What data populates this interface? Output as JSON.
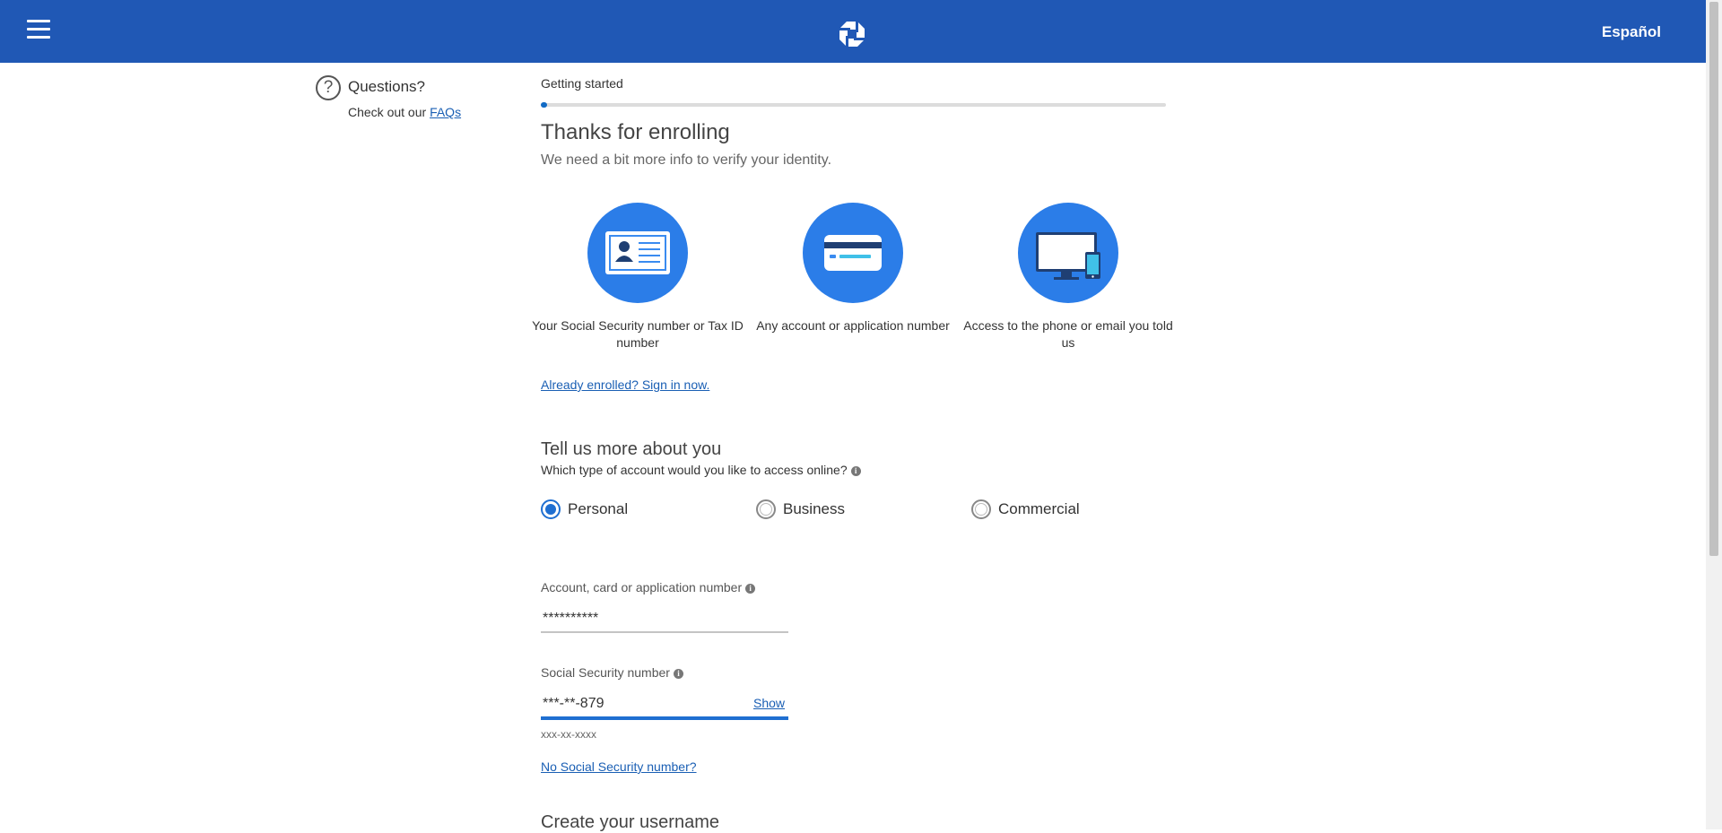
{
  "header": {
    "menu_icon": "hamburger-menu-icon",
    "logo_icon": "chase-octagon-logo-icon",
    "language_link": "Español",
    "brand_color": "#2058b5"
  },
  "sidebar": {
    "help_icon": "question-circle-icon",
    "help_glyph": "?",
    "questions_title": "Questions?",
    "faq_prefix": "Check out our ",
    "faq_link": "FAQs"
  },
  "progress": {
    "label": "Getting started",
    "percent": 1
  },
  "intro": {
    "title": "Thanks for enrolling",
    "subtitle": "We need a bit more info to verify your identity."
  },
  "requirements": [
    {
      "icon": "id-card-icon",
      "caption": "Your Social Security number or Tax ID number"
    },
    {
      "icon": "credit-card-icon",
      "caption": "Any account or application number"
    },
    {
      "icon": "computer-phone-icon",
      "caption": "Access to the phone or email you told us"
    }
  ],
  "signin_link": "Already enrolled? Sign in now.",
  "about": {
    "title": "Tell us more about you",
    "question": "Which type of account would you like to access online?",
    "info_glyph": "i",
    "options": [
      {
        "label": "Personal",
        "checked": true
      },
      {
        "label": "Business",
        "checked": false
      },
      {
        "label": "Commercial",
        "checked": false
      }
    ]
  },
  "account_field": {
    "label": "Account, card or application number",
    "value": "**********"
  },
  "ssn_field": {
    "label": "Social Security number",
    "value": "***-**-879",
    "show_link": "Show",
    "format_hint": "xxx-xx-xxxx",
    "no_ssn_link": "No Social Security number?"
  },
  "next_section_title": "Create your username",
  "colors": {
    "accent": "#1f6fd1",
    "icon_circle": "#2b7de8",
    "link": "#1a5fb4"
  }
}
